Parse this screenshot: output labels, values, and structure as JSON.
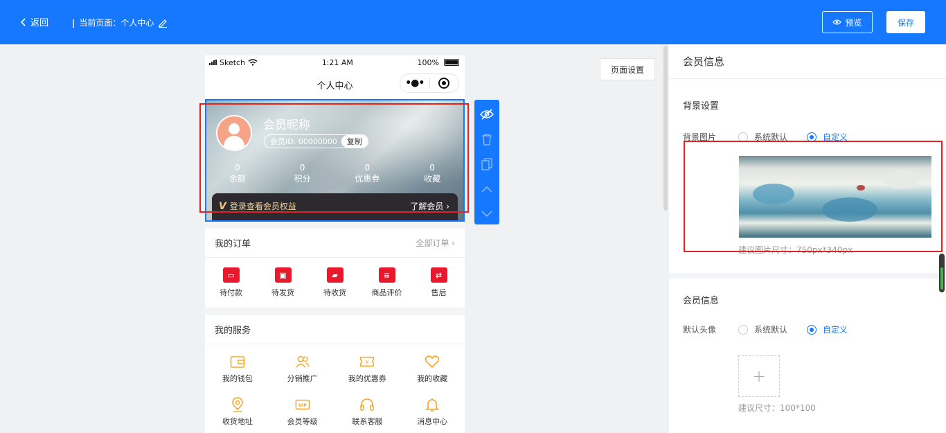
{
  "header": {
    "back_label": "返回",
    "current_page_label": "当前页面：个人中心",
    "preview_label": "预览",
    "save_label": "保存"
  },
  "phone": {
    "status": {
      "carrier": "Sketch",
      "time": "1:21 AM",
      "battery": "100%"
    },
    "nav_title": "个人中心",
    "member": {
      "nickname": "会员昵称",
      "member_id": "会员ID: 00000000",
      "copy_label": "复制",
      "stats": [
        {
          "value": "0",
          "label": "余额"
        },
        {
          "value": "0",
          "label": "积分"
        },
        {
          "value": "0",
          "label": "优惠券"
        },
        {
          "value": "0",
          "label": "收藏"
        }
      ],
      "vip_badge": "V",
      "vip_text": "登录查看会员权益",
      "vip_link": "了解会员"
    },
    "orders": {
      "title": "我的订单",
      "more": "全部订单",
      "items": [
        {
          "label": "待付款",
          "icon": "wallet-icon"
        },
        {
          "label": "待发货",
          "icon": "package-icon"
        },
        {
          "label": "待收货",
          "icon": "truck-icon"
        },
        {
          "label": "商品评价",
          "icon": "comment-icon"
        },
        {
          "label": "售后",
          "icon": "refund-icon"
        }
      ]
    },
    "services": {
      "title": "我的服务",
      "items": [
        {
          "label": "我的钱包",
          "icon": "wallet-icon"
        },
        {
          "label": "分销推广",
          "icon": "users-icon"
        },
        {
          "label": "我的优惠券",
          "icon": "ticket-icon"
        },
        {
          "label": "我的收藏",
          "icon": "heart-icon"
        },
        {
          "label": "收货地址",
          "icon": "location-icon"
        },
        {
          "label": "会员等级",
          "icon": "vip-icon"
        },
        {
          "label": "联系客服",
          "icon": "headset-icon"
        },
        {
          "label": "消息中心",
          "icon": "bell-icon"
        }
      ]
    }
  },
  "page_settings_label": "页面设置",
  "panel": {
    "title": "会员信息",
    "background": {
      "section_title": "背景设置",
      "field_label": "背景图片",
      "option_default": "系统默认",
      "option_custom": "自定义",
      "selected": "自定义",
      "hint": "建议图片尺寸：750px*340px"
    },
    "member_info": {
      "section_title": "会员信息",
      "field_label": "默认头像",
      "option_default": "系统默认",
      "option_custom": "自定义",
      "selected": "自定义",
      "hint": "建议尺寸：100*100"
    }
  },
  "colors": {
    "primary": "#1677ff",
    "highlight": "#e02424",
    "accent": "#f5a623",
    "order_icon": "#e8192c"
  }
}
